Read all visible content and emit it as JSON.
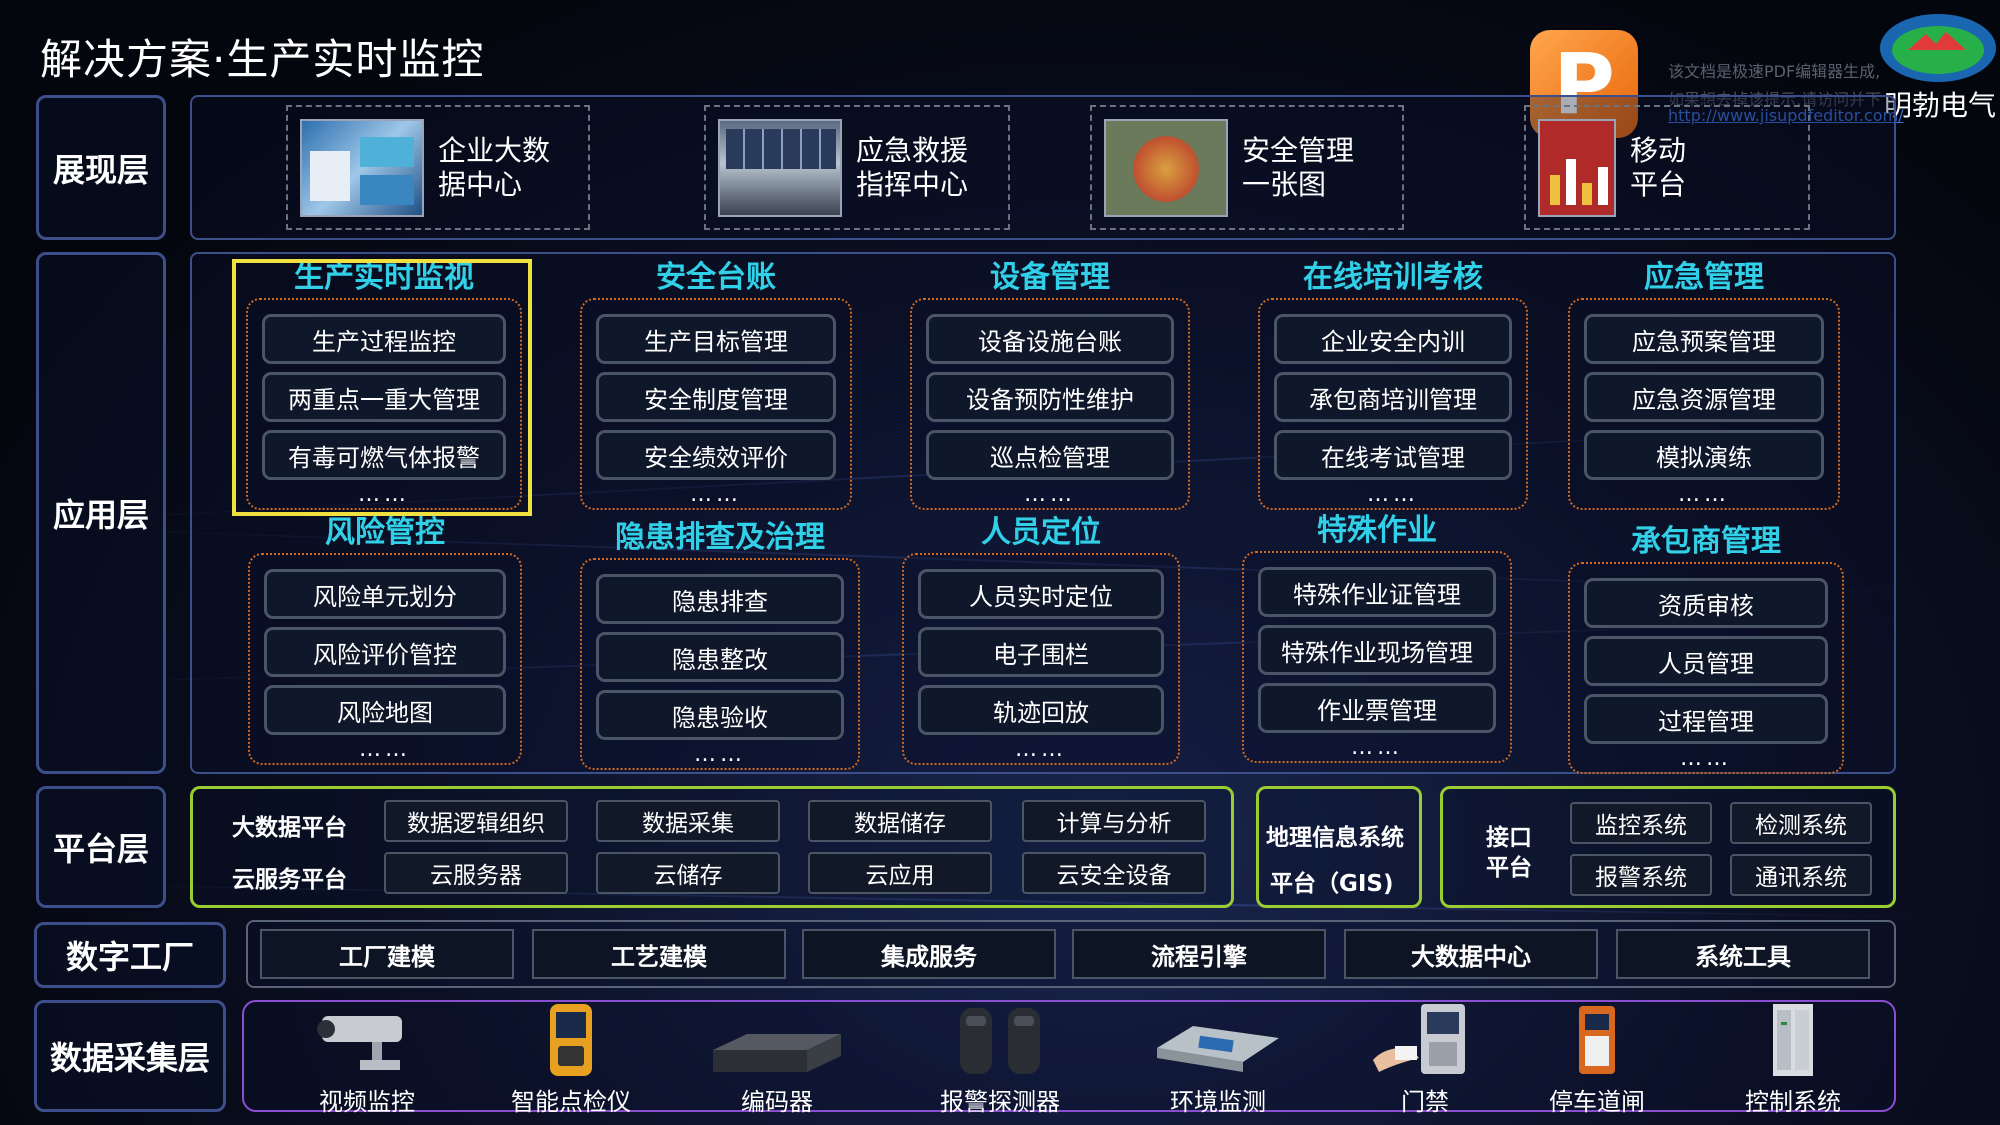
{
  "header": {
    "title": "解决方案·生产实时监控"
  },
  "watermark": {
    "line1": "该文档是极速PDF编辑器生成,",
    "line2": "如果想去掉该提示,请访问并下",
    "url": "http://www.jisupdfeditor.com/",
    "pdf_letter": "P"
  },
  "brand": {
    "name": "明勃电气"
  },
  "layers": {
    "presentation": "展现层",
    "application": "应用层",
    "platform": "平台层",
    "digital_factory": "数字工厂",
    "data_collection": "数据采集层"
  },
  "presentation": [
    {
      "line1": "企业大数",
      "line2": "据中心"
    },
    {
      "line1": "应急救援",
      "line2": "指挥中心"
    },
    {
      "line1": "安全管理",
      "line2": "一张图"
    },
    {
      "line1": "移动",
      "line2": "平台"
    }
  ],
  "modules": [
    {
      "title": "生产实时监视",
      "items": [
        "生产过程监控",
        "两重点一重大管理",
        "有毒可燃气体报警"
      ],
      "more": "……"
    },
    {
      "title": "安全台账",
      "items": [
        "生产目标管理",
        "安全制度管理",
        "安全绩效评价"
      ],
      "more": "……"
    },
    {
      "title": "设备管理",
      "items": [
        "设备设施台账",
        "设备预防性维护",
        "巡点检管理"
      ],
      "more": "……"
    },
    {
      "title": "在线培训考核",
      "items": [
        "企业安全内训",
        "承包商培训管理",
        "在线考试管理"
      ],
      "more": "……"
    },
    {
      "title": "应急管理",
      "items": [
        "应急预案管理",
        "应急资源管理",
        "模拟演练"
      ],
      "more": "……"
    },
    {
      "title": "风险管控",
      "items": [
        "风险单元划分",
        "风险评价管控",
        "风险地图"
      ],
      "more": "……"
    },
    {
      "title": "隐患排查及治理",
      "items": [
        "隐患排查",
        "隐患整改",
        "隐患验收"
      ],
      "more": "……"
    },
    {
      "title": "人员定位",
      "items": [
        "人员实时定位",
        "电子围栏",
        "轨迹回放"
      ],
      "more": "……"
    },
    {
      "title": "特殊作业",
      "items": [
        "特殊作业证管理",
        "特殊作业现场管理",
        "作业票管理"
      ],
      "more": "……"
    },
    {
      "title": "承包商管理",
      "items": [
        "资质审核",
        "人员管理",
        "过程管理"
      ],
      "more": "……"
    }
  ],
  "platform": {
    "bigdata": {
      "label": "大数据平台",
      "items": [
        "数据逻辑组织",
        "数据采集",
        "数据储存",
        "计算与分析"
      ]
    },
    "cloud": {
      "label": "云服务平台",
      "items": [
        "云服务器",
        "云储存",
        "云应用",
        "云安全设备"
      ]
    },
    "gis": {
      "line1": "地理信息系统",
      "line2": "平台（GIS)"
    },
    "interface": {
      "line1": "接口",
      "line2": "平台",
      "items": [
        "监控系统",
        "检测系统",
        "报警系统",
        "通讯系统"
      ]
    }
  },
  "digital_factory": [
    "工厂建模",
    "工艺建模",
    "集成服务",
    "流程引擎",
    "大数据中心",
    "系统工具"
  ],
  "devices": [
    "视频监控",
    "智能点检仪",
    "编码器",
    "报警探测器",
    "环境监测",
    "门禁",
    "停车道闸",
    "控制系统"
  ],
  "colors": {
    "accent": "#31d0e8",
    "highlight": "#f0e040",
    "platform_border": "#9acd32",
    "device_border": "#8a4fd0",
    "dotted": "#d2691e"
  }
}
